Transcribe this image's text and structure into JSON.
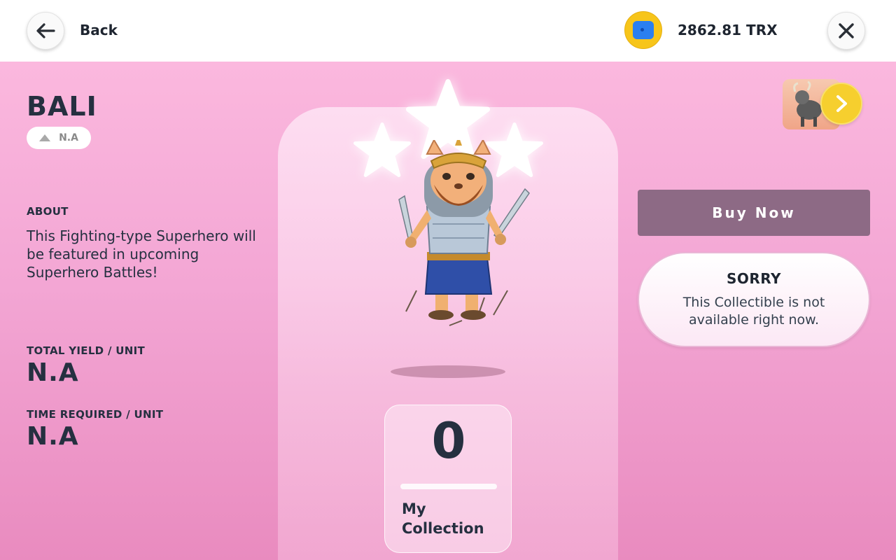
{
  "header": {
    "back_label": "Back",
    "balance": "2862.81 TRX",
    "icons": [
      "back-arrow-icon",
      "wallet-icon",
      "close-icon"
    ]
  },
  "hero": {
    "name": "BALI",
    "rank_value": "N.A",
    "stars": 3,
    "about_label": "ABOUT",
    "about_text": "This Fighting-type Superhero will be featured in upcoming Superhero Battles!",
    "yield_label": "TOTAL YIELD / UNIT",
    "yield_value": "N.A",
    "time_label": "TIME REQUIRED / UNIT",
    "time_value": "N.A"
  },
  "collection": {
    "count": "0",
    "label": "My Collection"
  },
  "actions": {
    "buy_label": "Buy Now",
    "sorry_title": "SORRY",
    "sorry_message": "This Collectible is not available right now."
  },
  "colors": {
    "panel_top": "#fbb8de",
    "panel_bottom": "#e98bbf",
    "buy_button": "#8d6a85",
    "coin": "#f7c51a",
    "text_dark": "#253040"
  }
}
